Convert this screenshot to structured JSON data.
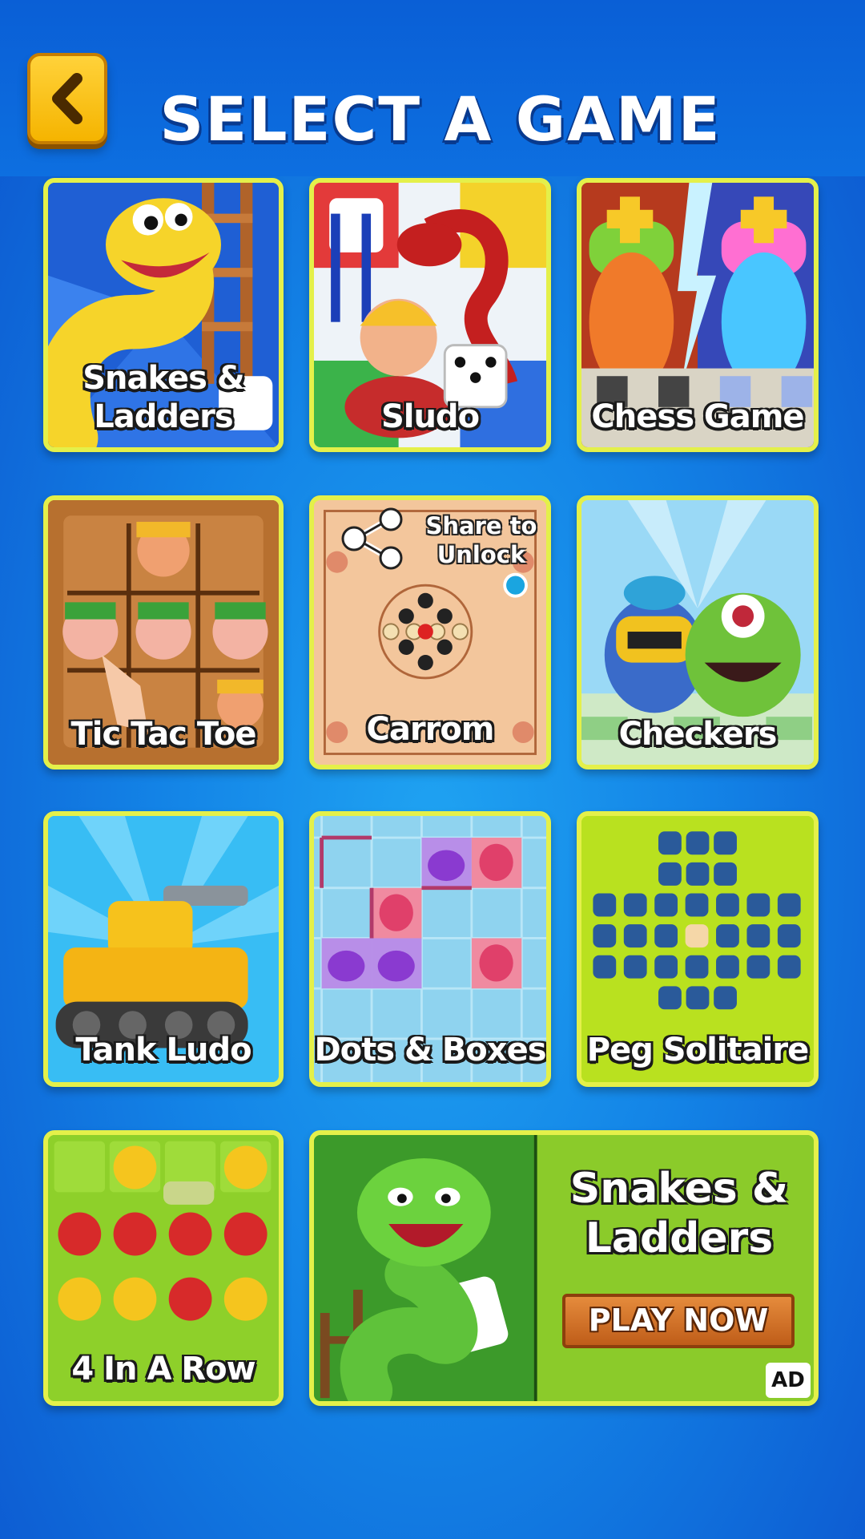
{
  "header": {
    "title": "SELECT A GAME"
  },
  "games": [
    {
      "label_line1": "Snakes &",
      "label_line2": "Ladders"
    },
    {
      "label": "Sludo"
    },
    {
      "label": "Chess Game"
    },
    {
      "label": "Tic Tac Toe"
    },
    {
      "label": "Carrom",
      "share_line1": "Share to",
      "share_line2": "Unlock"
    },
    {
      "label": "Checkers"
    },
    {
      "label": "Tank Ludo"
    },
    {
      "label": "Dots & Boxes"
    },
    {
      "label": "Peg Solitaire"
    },
    {
      "label": "4 In A Row"
    }
  ],
  "ad": {
    "title_line1": "Snakes &",
    "title_line2": "Ladders",
    "button": "PLAY NOW",
    "badge": "AD"
  },
  "icons": {
    "back": "chevron-left-icon",
    "share": "share-icon"
  },
  "colors": {
    "tile_border": "#e4f04a",
    "back_button": "#f5b400",
    "background": "#1383e6"
  }
}
